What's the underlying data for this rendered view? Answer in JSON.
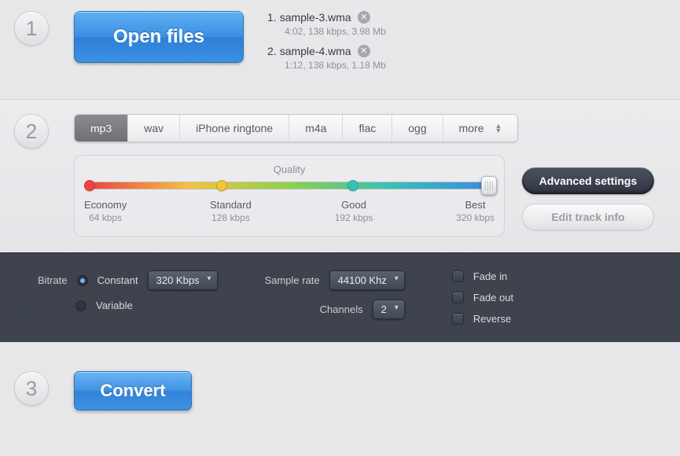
{
  "step_numbers": [
    "1",
    "2",
    "3"
  ],
  "open_files_label": "Open files",
  "files": [
    {
      "index": "1.",
      "name": "sample-3.wma",
      "meta": "4:02, 138 kbps, 3.98 Mb"
    },
    {
      "index": "2.",
      "name": "sample-4.wma",
      "meta": "1:12, 138 kbps, 1.18 Mb"
    }
  ],
  "formats": {
    "items": [
      "mp3",
      "wav",
      "iPhone ringtone",
      "m4a",
      "flac",
      "ogg"
    ],
    "more_label": "more",
    "active_index": 0
  },
  "quality": {
    "title": "Quality",
    "stops": [
      {
        "label": "Economy",
        "sub": "64 kbps",
        "pct": 0,
        "color": "#e44"
      },
      {
        "label": "Standard",
        "sub": "128 kbps",
        "pct": 33,
        "color": "#f5c23c"
      },
      {
        "label": "Good",
        "sub": "192 kbps",
        "pct": 66,
        "color": "#36c2b5"
      },
      {
        "label": "Best",
        "sub": "320 kbps",
        "pct": 100,
        "color": "#fff"
      }
    ],
    "value_pct": 100
  },
  "side": {
    "advanced": "Advanced settings",
    "edit_track": "Edit track info"
  },
  "advanced": {
    "bitrate_label": "Bitrate",
    "bitrate_mode": {
      "constant": "Constant",
      "variable": "Variable",
      "selected": "constant"
    },
    "bitrate_value": "320 Kbps",
    "sample_rate_label": "Sample rate",
    "sample_rate_value": "44100 Khz",
    "channels_label": "Channels",
    "channels_value": "2",
    "fade_in": "Fade in",
    "fade_out": "Fade out",
    "reverse": "Reverse"
  },
  "convert_label": "Convert"
}
